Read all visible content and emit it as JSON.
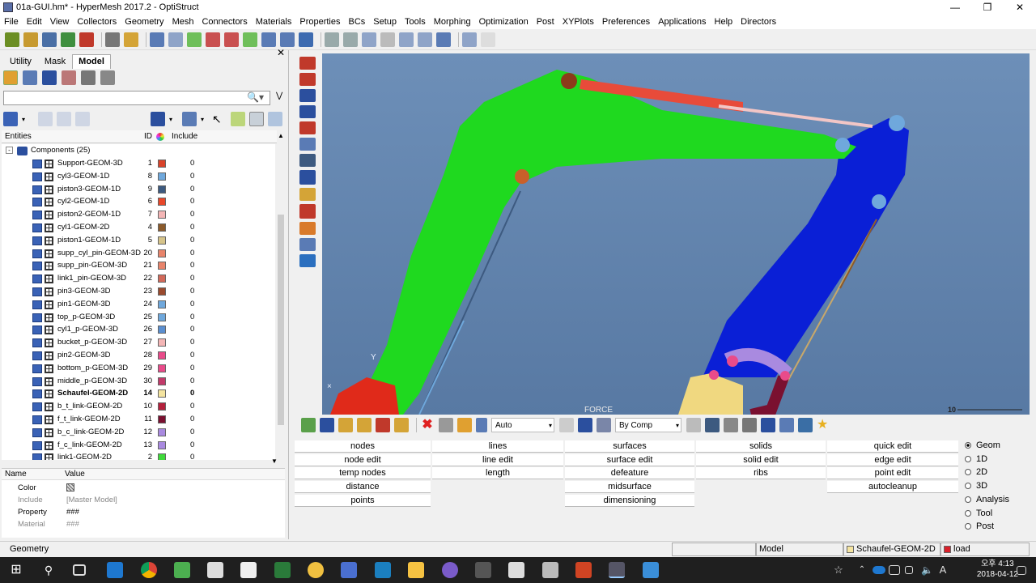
{
  "window": {
    "title": "01a-GUI.hm* - HyperMesh 2017.2 - OptiStruct"
  },
  "menu": [
    "File",
    "Edit",
    "View",
    "Collectors",
    "Geometry",
    "Mesh",
    "Connectors",
    "Materials",
    "Properties",
    "BCs",
    "Setup",
    "Tools",
    "Morphing",
    "Optimization",
    "Post",
    "XYPlots",
    "Preferences",
    "Applications",
    "Help",
    "Directors"
  ],
  "browser": {
    "tabs": [
      "Utility",
      "Mask",
      "Model"
    ],
    "active_tab": "Model",
    "columns": {
      "entities": "Entities",
      "id": "ID",
      "include": "Include"
    },
    "components_label": "Components (25)",
    "components": [
      {
        "name": "Support-GEOM-3D",
        "id": "1",
        "color": "#d9432a",
        "include": "0"
      },
      {
        "name": "cyl3-GEOM-1D",
        "id": "8",
        "color": "#6fa8dc",
        "include": "0"
      },
      {
        "name": "piston3-GEOM-1D",
        "id": "9",
        "color": "#3d5a80",
        "include": "0"
      },
      {
        "name": "cyl2-GEOM-1D",
        "id": "6",
        "color": "#e8472a",
        "include": "0"
      },
      {
        "name": "piston2-GEOM-1D",
        "id": "7",
        "color": "#f4b6b6",
        "include": "0"
      },
      {
        "name": "cyl1-GEOM-2D",
        "id": "4",
        "color": "#8b5a2b",
        "include": "0"
      },
      {
        "name": "piston1-GEOM-1D",
        "id": "5",
        "color": "#d6c48a",
        "include": "0"
      },
      {
        "name": "supp_cyl_pin-GEOM-3D",
        "id": "20",
        "color": "#e8846b",
        "include": "0"
      },
      {
        "name": "supp_pin-GEOM-3D",
        "id": "21",
        "color": "#e8846b",
        "include": "0"
      },
      {
        "name": "link1_pin-GEOM-3D",
        "id": "22",
        "color": "#d2695a",
        "include": "0"
      },
      {
        "name": "pin3-GEOM-3D",
        "id": "23",
        "color": "#9a4a2e",
        "include": "0"
      },
      {
        "name": "pin1-GEOM-3D",
        "id": "24",
        "color": "#6fa8dc",
        "include": "0"
      },
      {
        "name": "top_p-GEOM-3D",
        "id": "25",
        "color": "#6fa8dc",
        "include": "0"
      },
      {
        "name": "cyl1_p-GEOM-3D",
        "id": "26",
        "color": "#5b8fd0",
        "include": "0"
      },
      {
        "name": "bucket_p-GEOM-3D",
        "id": "27",
        "color": "#f4b6b6",
        "include": "0"
      },
      {
        "name": "pin2-GEOM-3D",
        "id": "28",
        "color": "#e94b8a",
        "include": "0"
      },
      {
        "name": "bottom_p-GEOM-3D",
        "id": "29",
        "color": "#e94b8a",
        "include": "0"
      },
      {
        "name": "middle_p-GEOM-3D",
        "id": "30",
        "color": "#c23a6a",
        "include": "0"
      },
      {
        "name": "Schaufel-GEOM-2D",
        "id": "14",
        "color": "#f4e4a0",
        "include": "0",
        "bold": true
      },
      {
        "name": "b_t_link-GEOM-2D",
        "id": "10",
        "color": "#b4203c",
        "include": "0"
      },
      {
        "name": "f_t_link-GEOM-2D",
        "id": "11",
        "color": "#7a1030",
        "include": "0"
      },
      {
        "name": "b_c_link-GEOM-2D",
        "id": "12",
        "color": "#a98ae0",
        "include": "0"
      },
      {
        "name": "f_c_link-GEOM-2D",
        "id": "13",
        "color": "#a98ae0",
        "include": "0"
      },
      {
        "name": "link1-GEOM-2D",
        "id": "2",
        "color": "#3fd93a",
        "include": "0"
      }
    ],
    "props_header": {
      "name": "Name",
      "value": "Value"
    },
    "props": [
      {
        "name": "Color",
        "value": ""
      },
      {
        "name": "Include",
        "value": "[Master Model]"
      },
      {
        "name": "Property",
        "value": "###"
      },
      {
        "name": "Material",
        "value": "###"
      }
    ]
  },
  "viewport": {
    "force_label": "FORCE",
    "scale_label": "10",
    "axis_label": "Y"
  },
  "bottombar": {
    "auto_label": "Auto",
    "bycomp_label": "By Comp"
  },
  "panel": {
    "col1": [
      "nodes",
      "node edit",
      "temp nodes",
      "distance",
      "points"
    ],
    "col2": [
      "lines",
      "line edit",
      "length"
    ],
    "col3": [
      "surfaces",
      "surface edit",
      "defeature",
      "midsurface",
      "dimensioning"
    ],
    "col4": [
      "solids",
      "solid edit",
      "ribs"
    ],
    "col5": [
      "quick edit",
      "edge edit",
      "point edit",
      "autocleanup"
    ],
    "radios": [
      "Geom",
      "1D",
      "2D",
      "3D",
      "Analysis",
      "Tool",
      "Post"
    ],
    "selected_radio": "Geom"
  },
  "status": {
    "left": "Geometry",
    "model": "Model",
    "comp": "Schaufel-GEOM-2D",
    "loadcol": "load",
    "comp_color": "#f4e4a0",
    "load_color": "#d9202a"
  },
  "taskbar": {
    "time": "오후 4:13",
    "date": "2018-04-12",
    "lang": "A"
  }
}
